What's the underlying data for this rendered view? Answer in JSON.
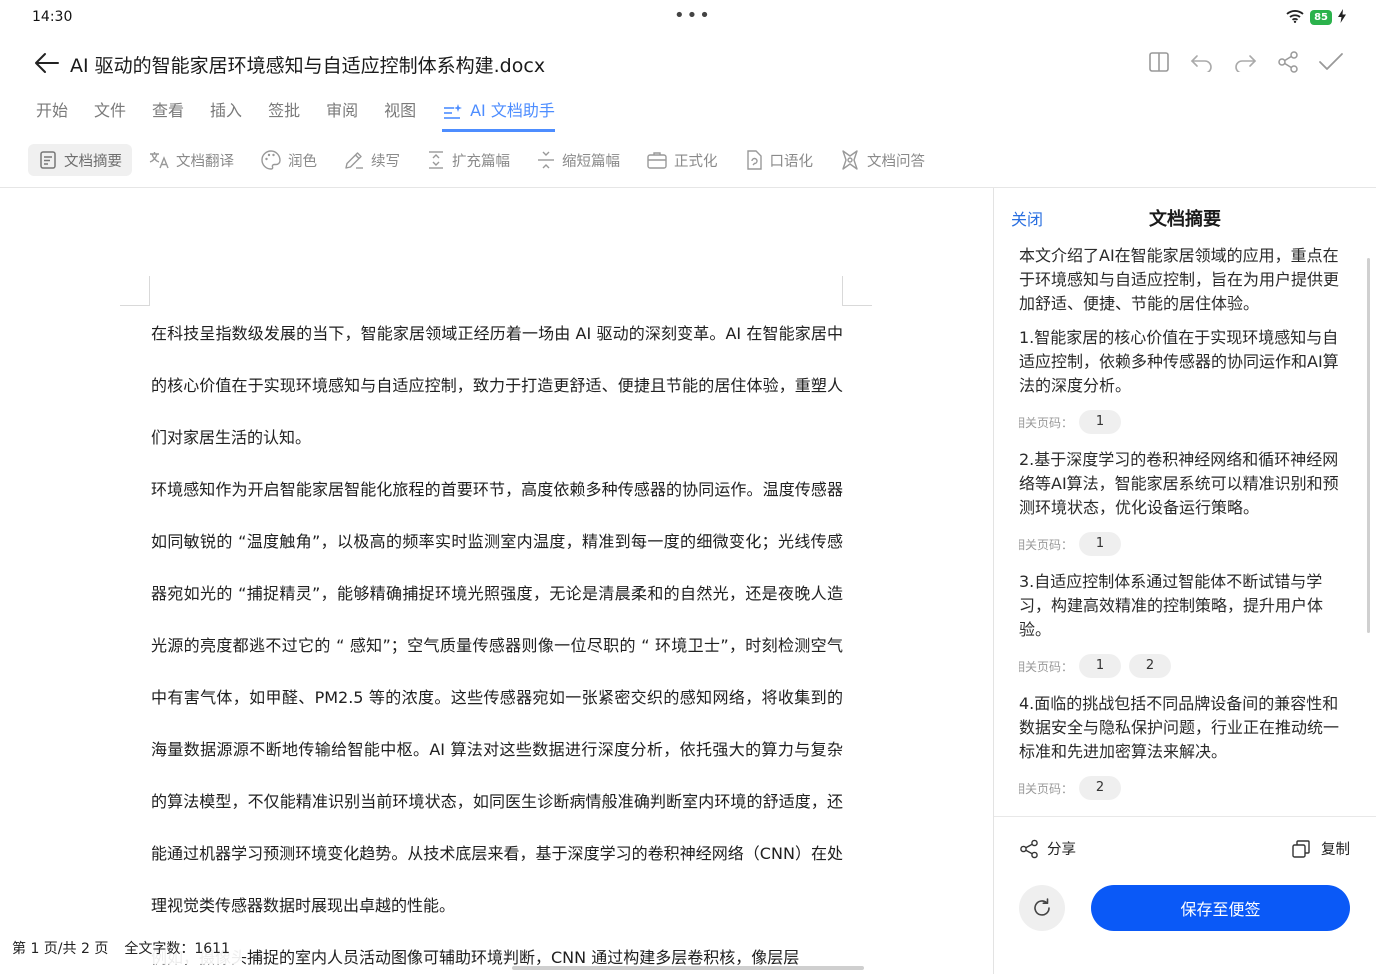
{
  "status_bar": {
    "time": "14:30",
    "battery": "85"
  },
  "title_bar": {
    "title": "AI 驱动的智能家居环境感知与自适应控制体系构建.docx"
  },
  "menu_tabs": [
    "开始",
    "文件",
    "查看",
    "插入",
    "签批",
    "审阅",
    "视图"
  ],
  "ai_tab": {
    "label": "AI 文档助手",
    "color": "#4d8dff"
  },
  "tools": [
    {
      "label": "文档摘要",
      "icon": "summary-icon"
    },
    {
      "label": "文档翻译",
      "icon": "translate-icon"
    },
    {
      "label": "润色",
      "icon": "palette-icon"
    },
    {
      "label": "续写",
      "icon": "pen-icon"
    },
    {
      "label": "扩充篇幅",
      "icon": "expand-icon"
    },
    {
      "label": "缩短篇幅",
      "icon": "shrink-icon"
    },
    {
      "label": "正式化",
      "icon": "briefcase-icon"
    },
    {
      "label": "口语化",
      "icon": "speech-doc-icon"
    },
    {
      "label": "文档问答",
      "icon": "qa-icon"
    }
  ],
  "document": {
    "paragraphs": [
      "在科技呈指数级发展的当下，智能家居领域正经历着一场由 AI 驱动的深刻变革。AI 在智能家居中的核心价值在于实现环境感知与自适应控制，致力于打造更舒适、便捷且节能的居住体验，重塑人们对家居生活的认知。",
      "环境感知作为开启智能家居智能化旅程的首要环节，高度依赖多种传感器的协同运作。温度传感器如同敏锐的 “温度触角”，以极高的频率实时监测室内温度，精准到每一度的细微变化；光线传感器宛如光的 “捕捉精灵”，能够精确捕捉环境光照强度，无论是清晨柔和的自然光，还是夜晚人造光源的亮度都逃不过它的 “ 感知”；空气质量传感器则像一位尽职的 “ 环境卫士”，时刻检测空气中有害气体，如甲醛、PM2.5 等的浓度。这些传感器宛如一张紧密交织的感知网络，将收集到的海量数据源源不断地传输给智能中枢。AI 算法对这些数据进行深度分析，依托强大的算力与复杂的算法模型，不仅能精准识别当前环境状态，如同医生诊断病情般准确判断室内环境的舒适度，还能通过机器学习预测环境变化趋势。从技术底层来看，基于深度学习的卷积神经网络（CNN）在处理视觉类传感器数据时展现出卓越的性能。",
      "例如，摄像头捕捉的室内人员活动图像可辅助环境判断，CNN 通过构建多层卷积核，像层层"
    ],
    "page_info": "第 1 页/共 2 页",
    "word_count": "全文字数：1611"
  },
  "panel": {
    "close_label": "关闭",
    "title": "文档摘要",
    "intro": "本文介绍了AI在智能家居领域的应用，重点在于环境感知与自适应控制，旨在为用户提供更加舒适、便捷、节能的居住体验。",
    "pages_label": "相关页码：",
    "points": [
      {
        "text": "1.智能家居的核心价值在于实现环境感知与自适应控制，依赖多种传感器的协同运作和AI算法的深度分析。",
        "pages": [
          "1"
        ]
      },
      {
        "text": "2.基于深度学习的卷积神经网络和循环神经网络等AI算法，智能家居系统可以精准识别和预测环境状态，优化设备运行策略。",
        "pages": [
          "1"
        ]
      },
      {
        "text": "3.自适应控制体系通过智能体不断试错与学习，构建高效精准的控制策略，提升用户体验。",
        "pages": [
          "1",
          "2"
        ]
      },
      {
        "text": "4.面临的挑战包括不同品牌设备间的兼容性和数据安全与隐私保护问题，行业正在推动统一标准和先进加密算法来解决。",
        "pages": [
          "2"
        ]
      }
    ],
    "share_label": "分享",
    "copy_label": "复制",
    "save_label": "保存至便签",
    "accent_color": "#0a59f7",
    "close_color": "#2a6fe0"
  }
}
